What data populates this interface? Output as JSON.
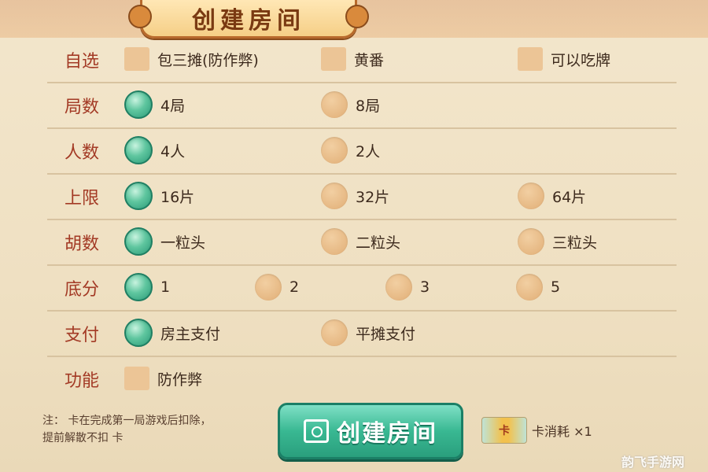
{
  "header": {
    "title": "创建房间"
  },
  "rows": [
    {
      "label": "自选",
      "options": [
        {
          "label": "包三摊(防作弊)",
          "type": "checkbox",
          "selected": false
        },
        {
          "label": "黄番",
          "type": "checkbox",
          "selected": false
        },
        {
          "label": "可以吃牌",
          "type": "checkbox",
          "selected": false
        }
      ]
    },
    {
      "label": "局数",
      "options": [
        {
          "label": "4局",
          "type": "radio",
          "selected": true
        },
        {
          "label": "8局",
          "type": "radio",
          "selected": false
        }
      ]
    },
    {
      "label": "人数",
      "options": [
        {
          "label": "4人",
          "type": "radio",
          "selected": true
        },
        {
          "label": "2人",
          "type": "radio",
          "selected": false
        }
      ]
    },
    {
      "label": "上限",
      "options": [
        {
          "label": "16片",
          "type": "radio",
          "selected": true
        },
        {
          "label": "32片",
          "type": "radio",
          "selected": false
        },
        {
          "label": "64片",
          "type": "radio",
          "selected": false
        }
      ]
    },
    {
      "label": "胡数",
      "options": [
        {
          "label": "一粒头",
          "type": "radio",
          "selected": true
        },
        {
          "label": "二粒头",
          "type": "radio",
          "selected": false
        },
        {
          "label": "三粒头",
          "type": "radio",
          "selected": false
        }
      ]
    },
    {
      "label": "底分",
      "options": [
        {
          "label": "1",
          "type": "radio",
          "selected": true
        },
        {
          "label": "2",
          "type": "radio",
          "selected": false
        },
        {
          "label": "3",
          "type": "radio",
          "selected": false
        },
        {
          "label": "5",
          "type": "radio",
          "selected": false
        }
      ]
    },
    {
      "label": "支付",
      "options": [
        {
          "label": "房主支付",
          "type": "radio",
          "selected": true
        },
        {
          "label": "平摊支付",
          "type": "radio",
          "selected": false
        }
      ]
    },
    {
      "label": "功能",
      "options": [
        {
          "label": "防作弊",
          "type": "checkbox",
          "selected": false
        }
      ]
    }
  ],
  "footer": {
    "note_line1": "注：   卡在完成第一局游戏后扣除，",
    "note_line2": "提前解散不扣   卡",
    "create_button": "创建房间",
    "card_icon_label": "卡",
    "cost_text": "  卡消耗 ×1"
  },
  "watermark": "韵飞手游网",
  "colors": {
    "selected": "#2b9a78",
    "unselected": "#e6b883",
    "label": "#a33a25"
  }
}
